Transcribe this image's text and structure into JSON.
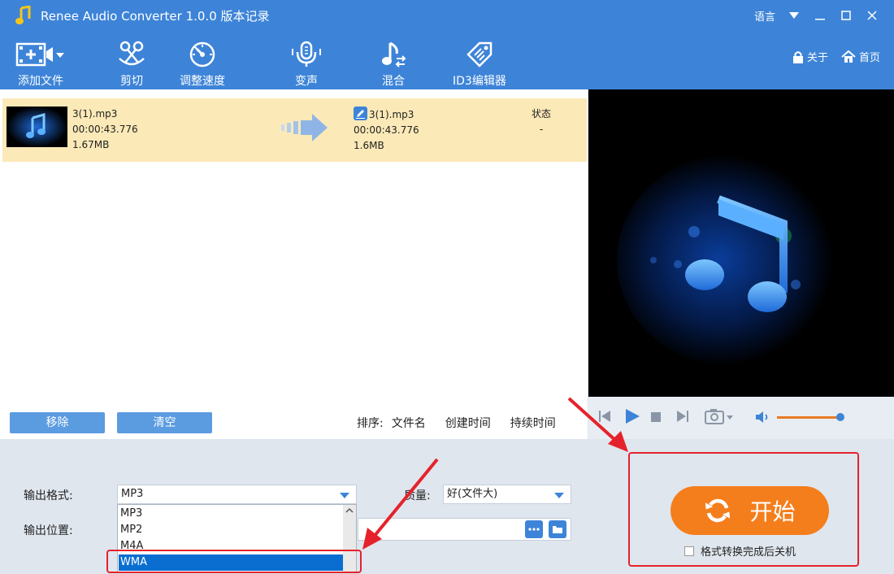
{
  "window": {
    "title": "Renee Audio Converter 1.0.0 版本记录",
    "language_label": "语言"
  },
  "toolbar": {
    "add_file": "添加文件",
    "cut": "剪切",
    "speed": "调整速度",
    "voice": "变声",
    "mix": "混合",
    "id3": "ID3编辑器",
    "about": "关于",
    "home": "首页"
  },
  "file_list": {
    "items": [
      {
        "source_name": "3(1).mp3",
        "source_duration": "00:00:43.776",
        "source_size": "1.67MB",
        "output_name": "3(1).mp3",
        "output_duration": "00:00:43.776",
        "output_size": "1.6MB",
        "status_header": "状态",
        "status_value": "-"
      }
    ]
  },
  "list_controls": {
    "remove": "移除",
    "clear": "清空",
    "sort_label": "排序:",
    "sort_name": "文件名",
    "sort_created": "创建时间",
    "sort_duration": "持续时间"
  },
  "player": {
    "volume": 0.95
  },
  "settings": {
    "format_label": "输出格式:",
    "format_value": "MP3",
    "format_options": [
      "MP3",
      "MP2",
      "M4A",
      "WMA"
    ],
    "format_highlighted": "WMA",
    "quality_label": "质量:",
    "quality_value": "好(文件大)",
    "location_label": "输出位置:",
    "start_label": "开始",
    "shutdown_label": "格式转换完成后关机"
  },
  "colors": {
    "brand_blue": "#3d84d8",
    "start_orange": "#f57e1c",
    "highlight_red": "#e5222b",
    "row_selected": "#fbe9b7"
  }
}
